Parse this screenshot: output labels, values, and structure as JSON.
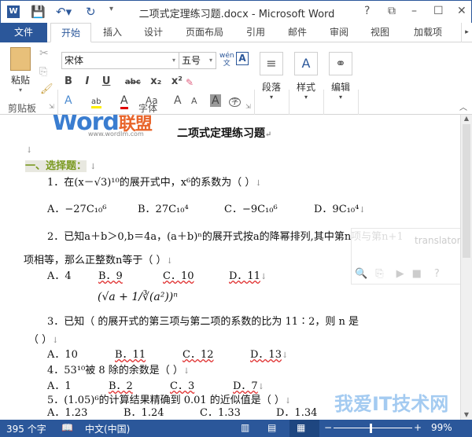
{
  "window": {
    "title": "二项式定理练习题.docx - Microsoft Word",
    "app_icon": "word-icon",
    "controls": [
      "?",
      "⧉",
      "–",
      "☐",
      "✕"
    ]
  },
  "tabs": [
    {
      "label": "文件"
    },
    {
      "label": "开始"
    },
    {
      "label": "插入"
    },
    {
      "label": "设计"
    },
    {
      "label": "页面布局"
    },
    {
      "label": "引用"
    },
    {
      "label": "邮件"
    },
    {
      "label": "审阅"
    },
    {
      "label": "视图"
    },
    {
      "label": "加载项"
    }
  ],
  "ribbon": {
    "clipboard": {
      "paste": "粘贴",
      "group": "剪贴板"
    },
    "font": {
      "name": "宋体",
      "size": "五号",
      "pinyin": "wén",
      "group": "字体",
      "format_buttons": [
        "B",
        "I",
        "U",
        "abc",
        "x₂",
        "x²"
      ],
      "row3": [
        "A",
        "A",
        "Aa",
        "A",
        "A",
        "A",
        "字"
      ]
    },
    "paragraph": "段落",
    "styles": "样式",
    "editing": "编辑"
  },
  "document": {
    "logo": "Word联盟",
    "logo_url": "www.wordlm.com",
    "title": "二项式定理练习题",
    "section": "一、选择题：",
    "q1": "1．在(x－√3)¹⁰的展开式中，x⁶的系数为（  ）",
    "q1_options": [
      "A．−27C₁₀⁶",
      "B．27C₁₀⁴",
      "C．−9C₁₀⁶",
      "D．9C₁₀⁴"
    ],
    "q2": "2．已知a＋b＞0,b＝4a，(a＋b)ⁿ的展开式按a的降幂排列,其中第n项与第n+1",
    "q2_cont": "项相等，那么正整数n等于（  ）",
    "q2_options": [
      "A．4",
      "B．9",
      "C．10",
      "D．11"
    ],
    "q3_formula": "(√a + 1/∛(a²))ⁿ",
    "q3": "3．已知（                    的展开式的第三项与第二项的系数的比为 11∶2，则 n 是",
    "q3_cont": "（  ）",
    "q3_options": [
      "A．10",
      "B．11",
      "C．12",
      "D．13"
    ],
    "q4": "4．53¹⁰被 8 除的余数是（  ）",
    "q4_options": [
      "A．1",
      "B．2",
      "C．3",
      "D．7"
    ],
    "q5": "5．(1.05)⁶的计算结果精确到 0.01 的近似值是（  ）",
    "q5_options": [
      "A．1.23",
      "B．1.24",
      "C．1.33",
      "D．1.34"
    ]
  },
  "translator": {
    "label": "translator"
  },
  "watermark": "我爱IT技术网",
  "status": {
    "words": "395 个字",
    "language": "中文(中国)",
    "zoom": "99%",
    "zoom_level": 0.99
  }
}
